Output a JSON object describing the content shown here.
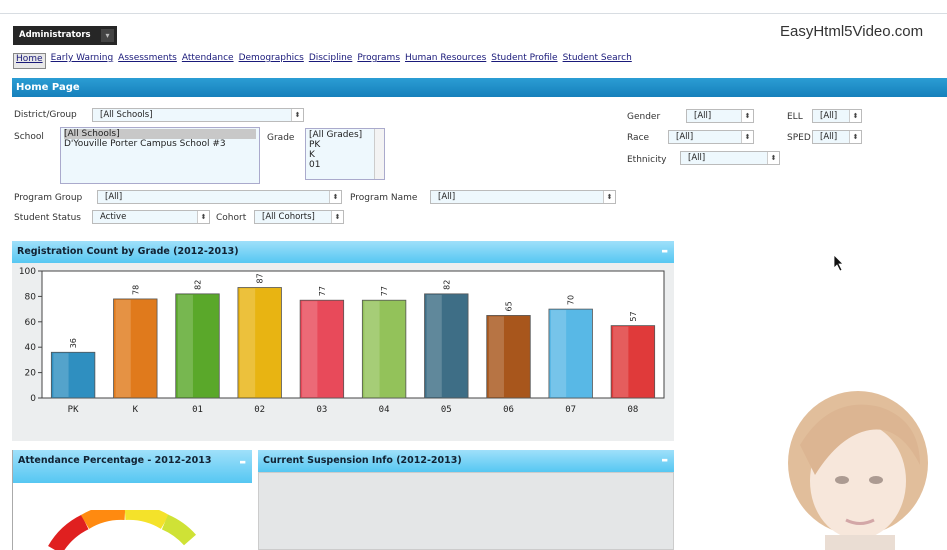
{
  "role_menu": {
    "label": "Administrators",
    "dropdown_icon": "chevron-down-icon"
  },
  "watermark": "EasyHtml5Video.com",
  "nav": [
    "Home",
    "Early Warning",
    "Assessments",
    "Attendance",
    "Demographics",
    "Discipline",
    "Programs",
    "Human Resources",
    "Student Profile",
    "Student Search"
  ],
  "page_title": "Home Page",
  "filters": {
    "district_label": "District/Group",
    "district_value": "[All Schools]",
    "school_label": "School",
    "school_options": [
      "[All Schools]",
      "D'Youville Porter Campus School #3"
    ],
    "grade_label": "Grade",
    "grade_options": [
      "[All Grades]",
      "PK",
      "K",
      "01"
    ],
    "gender_label": "Gender",
    "gender_value": "[All]",
    "race_label": "Race",
    "race_value": "[All]",
    "ethnicity_label": "Ethnicity",
    "ethnicity_value": "[All]",
    "ell_label": "ELL",
    "ell_value": "[All]",
    "sped_label": "SPED",
    "sped_value": "[All]",
    "program_group_label": "Program Group",
    "program_group_value": "[All]",
    "program_name_label": "Program Name",
    "program_name_value": "[All]",
    "student_status_label": "Student Status",
    "student_status_value": "Active",
    "cohort_label": "Cohort",
    "cohort_value": "[All Cohorts]"
  },
  "panels": {
    "registration_title": "Registration Count by Grade (2012-2013)",
    "attendance_title": "Attendance Percentage - 2012-2013",
    "suspension_title": "Current Suspension Info (2012-2013)"
  },
  "chart_data": {
    "type": "bar",
    "title": "Registration Count by Grade (2012-2013)",
    "categories": [
      "PK",
      "K",
      "01",
      "02",
      "03",
      "04",
      "05",
      "06",
      "07",
      "08"
    ],
    "values": [
      36,
      78,
      82,
      87,
      77,
      77,
      82,
      65,
      70,
      57
    ],
    "colors": [
      "#2f8fc0",
      "#e07a1c",
      "#5aa82a",
      "#e8b412",
      "#e84a5a",
      "#93c25a",
      "#3e6e86",
      "#a8561c",
      "#58b8e6",
      "#e03a3a"
    ],
    "ylim": [
      0,
      100
    ],
    "yticks": [
      0,
      20,
      40,
      60,
      80,
      100
    ]
  }
}
